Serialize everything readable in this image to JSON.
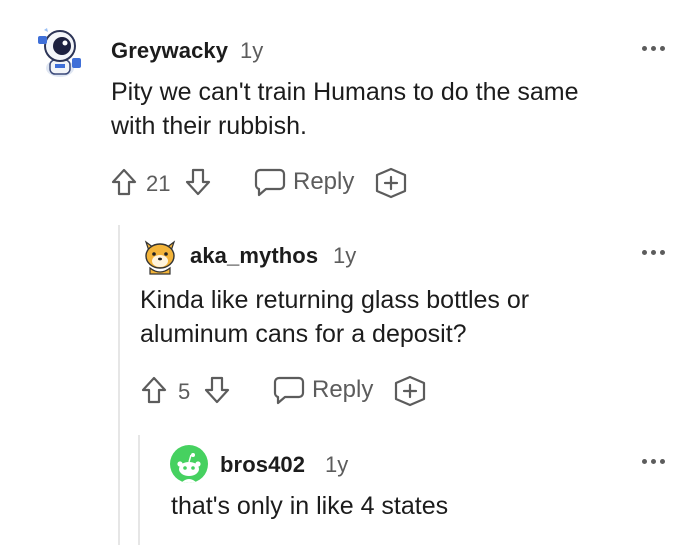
{
  "comments": [
    {
      "username": "Greywacky",
      "time": "1y",
      "body_lines": [
        "Pity we can't train Humans to do the same",
        "with their rubbish."
      ],
      "votes": "21",
      "reply_label": "Reply",
      "avatar_icon": "astronaut-avatar-icon"
    },
    {
      "username": "aka_mythos",
      "time": "1y",
      "body_lines": [
        "Kinda like returning glass bottles or",
        "aluminum cans for a deposit?"
      ],
      "votes": "5",
      "reply_label": "Reply",
      "avatar_icon": "shiba-avatar-icon"
    },
    {
      "username": "bros402",
      "time": "1y",
      "body_lines": [
        "that's only in like 4 states"
      ],
      "avatar_icon": "snoo-avatar-icon"
    }
  ],
  "colors": {
    "text": "#1c1c1c",
    "meta": "#5c5c5c",
    "thread_line": "#e6e6e6",
    "snoo_green": "#46d160"
  }
}
